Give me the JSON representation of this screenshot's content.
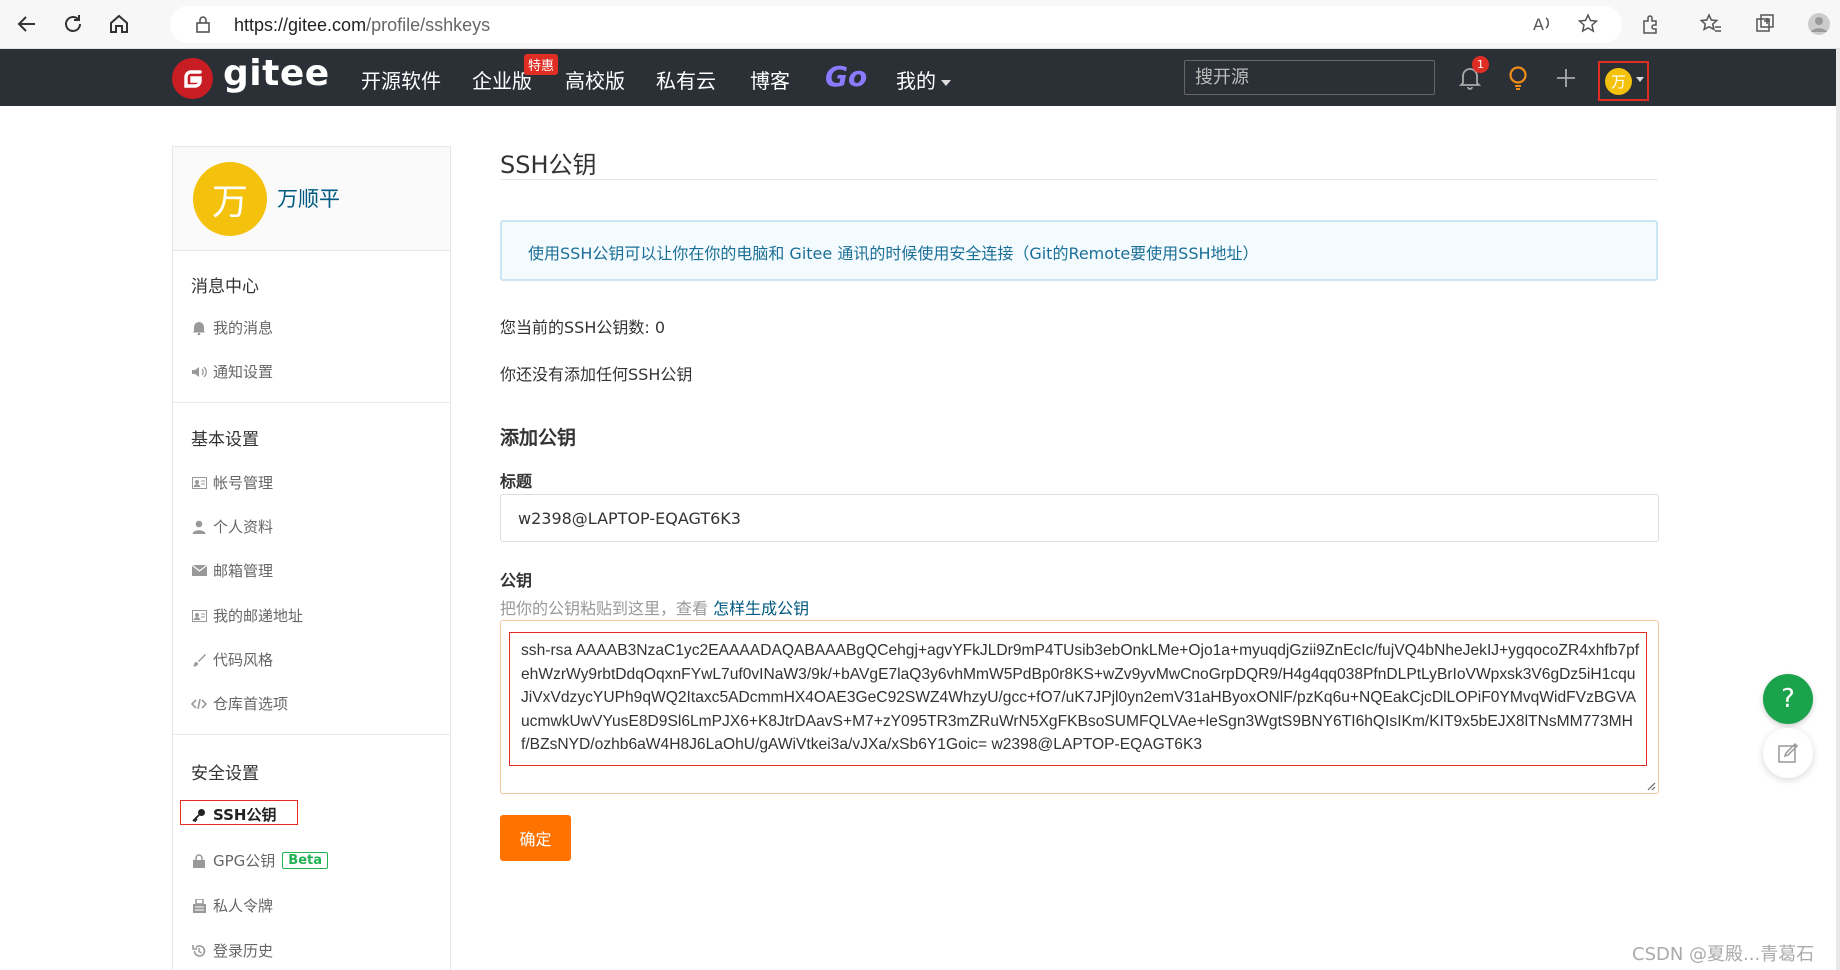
{
  "browser": {
    "url_host": "https://gitee.com",
    "url_path": "/profile/sshkeys"
  },
  "navbar": {
    "logo": "gitee",
    "items": [
      "开源软件",
      "企业版",
      "高校版",
      "私有云",
      "博客"
    ],
    "go_label": "Go",
    "promo_badge": "特惠",
    "mine_label": "我的",
    "search_placeholder": "搜开源",
    "notification_count": "1",
    "avatar_initial": "万"
  },
  "sidebar": {
    "avatar_initial": "万",
    "username": "万顺平",
    "sections": [
      {
        "title": "消息中心",
        "items": [
          {
            "label": "我的消息",
            "icon": "bell-icon"
          },
          {
            "label": "通知设置",
            "icon": "speaker-icon"
          }
        ]
      },
      {
        "title": "基本设置",
        "items": [
          {
            "label": "帐号管理",
            "icon": "id-card-icon"
          },
          {
            "label": "个人资料",
            "icon": "user-icon"
          },
          {
            "label": "邮箱管理",
            "icon": "envelope-icon"
          },
          {
            "label": "我的邮递地址",
            "icon": "address-card-icon"
          },
          {
            "label": "代码风格",
            "icon": "brush-icon"
          },
          {
            "label": "仓库首选项",
            "icon": "code-icon"
          }
        ]
      },
      {
        "title": "安全设置",
        "items": [
          {
            "label": "SSH公钥",
            "icon": "key-icon",
            "active": true
          },
          {
            "label": "GPG公钥",
            "icon": "lock-icon",
            "badge": "Beta"
          },
          {
            "label": "私人令牌",
            "icon": "token-icon"
          },
          {
            "label": "登录历史",
            "icon": "history-icon"
          }
        ]
      }
    ]
  },
  "main": {
    "title": "SSH公钥",
    "info": "使用SSH公钥可以让你在你的电脑和 Gitee 通讯的时候使用安全连接（Git的Remote要使用SSH地址）",
    "key_count": "您当前的SSH公钥数: 0",
    "no_key": "你还没有添加任何SSH公钥",
    "add_title": "添加公钥",
    "title_label": "标题",
    "title_value": "w2398@LAPTOP-EQAGT6K3",
    "key_label": "公钥",
    "key_hint": "把你的公钥粘贴到这里，查看 ",
    "key_hint_link": "怎样生成公钥",
    "key_value": "ssh-rsa AAAAB3NzaC1yc2EAAAADAQABAAABgQCehgj+agvYFkJLDr9mP4TUsib3ebOnkLMe+Ojo1a+myuqdjGzii9ZnEcIc/fujVQ4bNheJekIJ+ygqocoZR4xhfb7pfehWzrWy9rbtDdqOqxnFYwL7uf0vINaW3/9k/+bAVgE7laQ3y6vhMmW5PdBp0r8KS+wZv9yvMwCnoGrpDQR9/H4g4qq038PfnDLPtLyBrIoVWpxsk3V6gDz5iH1cquJiVxVdzycYUPh9qWQ2Itaxc5ADcmmHX4OAE3GeC92SWZ4WhzyU/gcc+fO7/uK7JPjl0yn2emV31aHByoxONlF/pzKq6u+NQEakCjcDlLOPiF0YMvqWidFVzBGVAucmwkUwVYusE8D9Sl6LmPJX6+K8JtrDAavS+M7+zY095TR3mZRuWrN5XgFKBsoSUMFQLVAe+leSgn3WgtS9BNY6TI6hQIsIKm/KIT9x5bEJX8lTNsMM773MHf/BZsNYD/ozhb6aW4H8J6LaOhU/gAWiVtkei3a/vJXa/xSb6Y1Goic= w2398@LAPTOP-EQAGT6K3",
    "submit_label": "确定"
  },
  "float": {
    "help_label": "?"
  },
  "watermark": "CSDN @夏殿...青葛石"
}
